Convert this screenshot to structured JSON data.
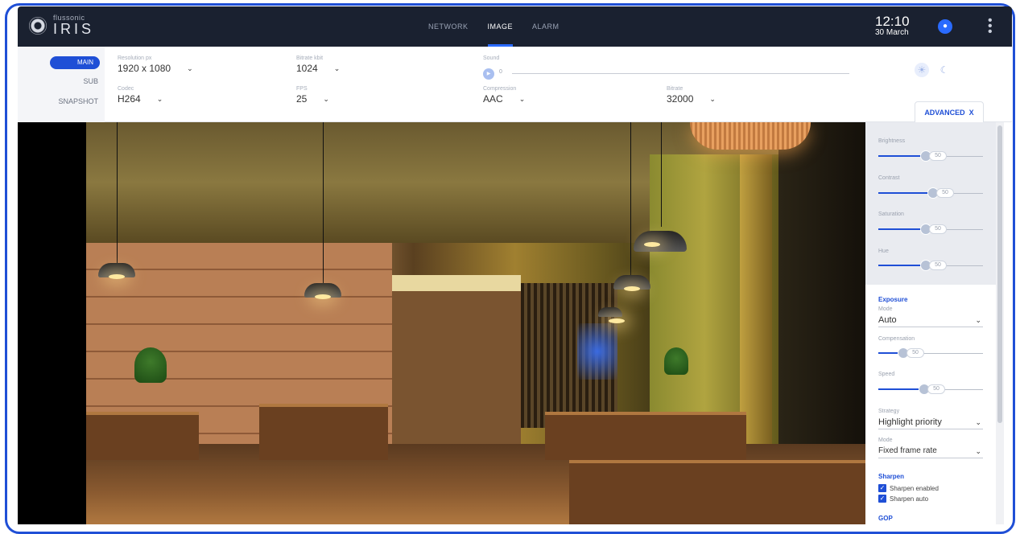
{
  "brand": {
    "small": "flussonic",
    "big": "IRIS"
  },
  "nav": {
    "items": [
      "NETWORK",
      "IMAGE",
      "ALARM"
    ],
    "active": "IMAGE"
  },
  "clock": {
    "time": "12:10",
    "date": "30 March"
  },
  "streams": {
    "main": "MAIN",
    "sub": "SUB",
    "snapshot": "SNAPSHOT"
  },
  "settings": {
    "resolution": {
      "label": "Resolution px",
      "value": "1920 x 1080"
    },
    "codec": {
      "label": "Codec",
      "value": "H264"
    },
    "bitrate_kbit": {
      "label": "Bitrate kbit",
      "value": "1024"
    },
    "fps": {
      "label": "FPS",
      "value": "25"
    },
    "sound": {
      "label": "Sound",
      "value": "0"
    },
    "compression": {
      "label": "Compression",
      "value": "AAC"
    },
    "bitrate": {
      "label": "Bitrate",
      "value": "32000"
    }
  },
  "advanced_tab": {
    "label": "ADVANCED",
    "close": "X"
  },
  "image_adjust": [
    {
      "label": "Brightness",
      "value": "50",
      "level": 0.45
    },
    {
      "label": "Contrast",
      "value": "50",
      "level": 0.52
    },
    {
      "label": "Saturation",
      "value": "50",
      "level": 0.45
    },
    {
      "label": "Hue",
      "value": "50",
      "level": 0.45
    }
  ],
  "exposure": {
    "title": "Exposure",
    "mode": {
      "label": "Mode",
      "value": "Auto"
    },
    "compensation": {
      "label": "Compensation",
      "value": "50",
      "level": 0.24
    },
    "speed": {
      "label": "Speed",
      "value": "50",
      "level": 0.44
    },
    "strategy": {
      "label": "Strategy",
      "value": "Highlight priority"
    },
    "fmode": {
      "label": "Mode",
      "value": "Fixed frame rate"
    }
  },
  "sharpen": {
    "title": "Sharpen",
    "enabled": "Sharpen enabled",
    "auto": "Sharpen auto"
  },
  "gop": {
    "title": "GOP"
  },
  "colors": {
    "accent": "#1f4fd6",
    "topbar": "#1a2130",
    "frame": "#1f4fd6"
  }
}
